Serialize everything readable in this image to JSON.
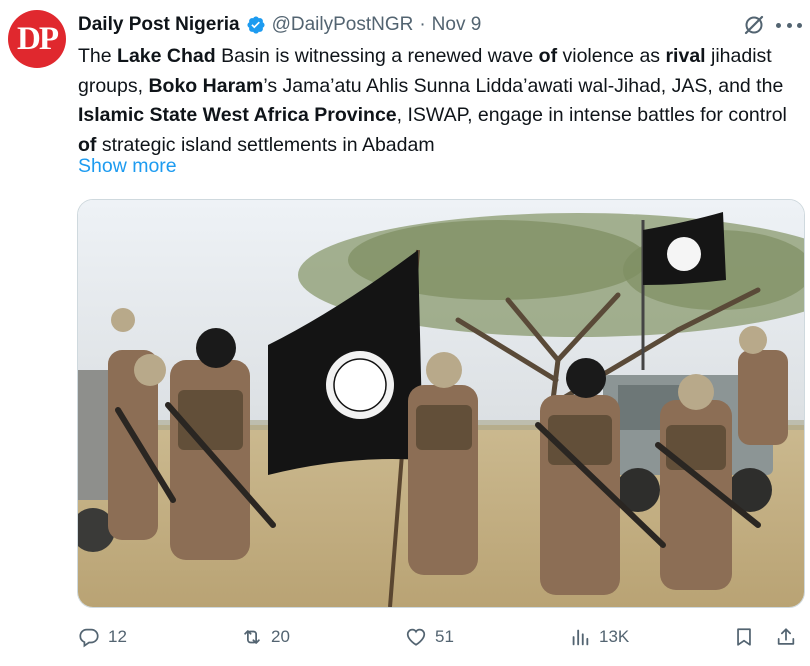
{
  "author": {
    "avatar_initials": "DP",
    "name": "Daily Post Nigeria",
    "handle": "@DailyPostNGR",
    "separator": "·",
    "date": "Nov 9"
  },
  "tweet": {
    "segments": [
      {
        "t": "The ",
        "b": false
      },
      {
        "t": "Lake Chad",
        "b": true
      },
      {
        "t": " Basin is witnessing a renewed wave ",
        "b": false
      },
      {
        "t": "of",
        "b": true
      },
      {
        "t": " violence as ",
        "b": false
      },
      {
        "t": "rival",
        "b": true
      },
      {
        "t": " jihadist groups, ",
        "b": false
      },
      {
        "t": "Boko Haram",
        "b": true
      },
      {
        "t": "’s Jama’atu Ahlis Sunna Lidda’awati wal-Jihad, JAS, and the ",
        "b": false
      },
      {
        "t": "Islamic State West Africa Province",
        "b": true
      },
      {
        "t": ", ISWAP, engage in intense battles for control ",
        "b": false
      },
      {
        "t": "of",
        "b": true
      },
      {
        "t": " strategic island settlements in Abadam",
        "b": false
      }
    ],
    "show_more": "Show more"
  },
  "actions": {
    "replies": "12",
    "reposts": "20",
    "likes": "51",
    "views": "13K"
  },
  "colors": {
    "accent": "#1d9bf0",
    "avatar_bg": "#e0282e",
    "muted": "#536471"
  }
}
